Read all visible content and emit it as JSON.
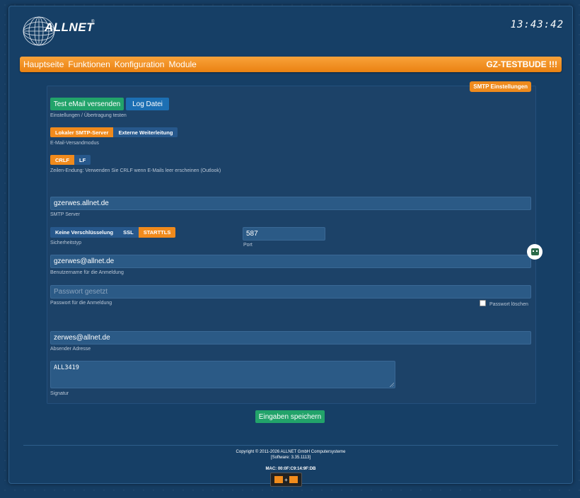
{
  "header": {
    "brand": "ALLNET",
    "brand_reg": "®",
    "clock": "13:43:42"
  },
  "nav": {
    "items": [
      "Hauptseite",
      "Funktionen",
      "Konfiguration",
      "Module"
    ],
    "device_name": "GZ-TESTBUDE !!!"
  },
  "panel": {
    "badge": "SMTP Einstellungen",
    "test_button": "Test eMail versenden",
    "log_button": "Log Datei",
    "test_label": "Einstellungen / Übertragung testen",
    "mode_options": [
      "Lokaler SMTP-Server",
      "Externe Weiterleitung"
    ],
    "mode_selected": "Lokaler SMTP-Server",
    "mode_label": "E-Mail-Versandmodus",
    "line_options": [
      "CRLF",
      "LF"
    ],
    "line_selected": "CRLF",
    "line_label": "Zeilen-Endung: Verwenden Sie CRLF wenn E-Mails leer erscheinen (Outlook)",
    "smtp_server": "gzerwes.allnet.de",
    "smtp_server_label": "SMTP Server",
    "security_options": [
      "Keine Verschlüsselung",
      "SSL",
      "STARTTLS"
    ],
    "security_selected": "STARTTLS",
    "security_label": "Sicherheitstyp",
    "port": "587",
    "port_label": "Port",
    "username": "gzerwes@allnet.de",
    "username_label": "Benutzername für die Anmeldung",
    "password_placeholder": "Passwort gesetzt",
    "password_label": "Passwort für die Anmeldung",
    "password_delete_label": "Passwort löschen",
    "password_delete_checked": false,
    "sender": "zerwes@allnet.de",
    "sender_label": "Absender Adresse",
    "signature": "ALL3419",
    "signature_label": "Signatur"
  },
  "save_button": "Eingaben speichern",
  "footer": {
    "copyright": "Copyright © 2011-2026 ALLNET GmbH Computersysteme",
    "software": "[Software: 3.35.1113]",
    "mac": "MAC: 00:0F:C9:14:9F:DB"
  },
  "colors": {
    "accent": "#f08a1c",
    "primary": "#1c6fb3",
    "success": "#22a36a",
    "background": "#163d63"
  }
}
